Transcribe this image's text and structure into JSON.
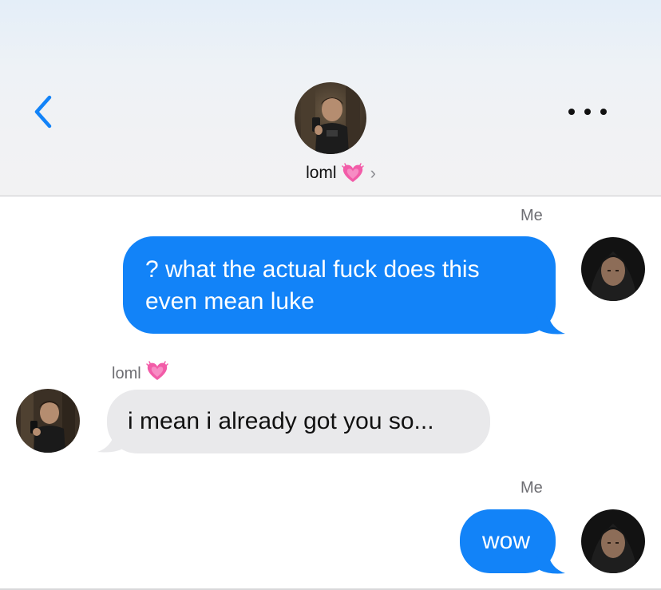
{
  "header": {
    "contact_name": "loml",
    "name_emoji": "heart-icon",
    "back_icon": "chevron-left-icon",
    "details_icon": "chevron-right-icon",
    "more_icon": "more-dots-icon"
  },
  "messages": [
    {
      "sender": "Me",
      "direction": "outgoing",
      "text_line1": "? what the actual fuck does this",
      "text_line2": "even mean luke"
    },
    {
      "sender": "loml",
      "direction": "incoming",
      "text": "i mean i already got you so..."
    },
    {
      "sender": "Me",
      "direction": "outgoing",
      "text": "wow"
    }
  ],
  "colors": {
    "accent_blue": "#1283f8",
    "incoming_bubble": "#e9e9eb",
    "heart_pink": "#f25ca8",
    "label_gray": "#6d6d72"
  }
}
